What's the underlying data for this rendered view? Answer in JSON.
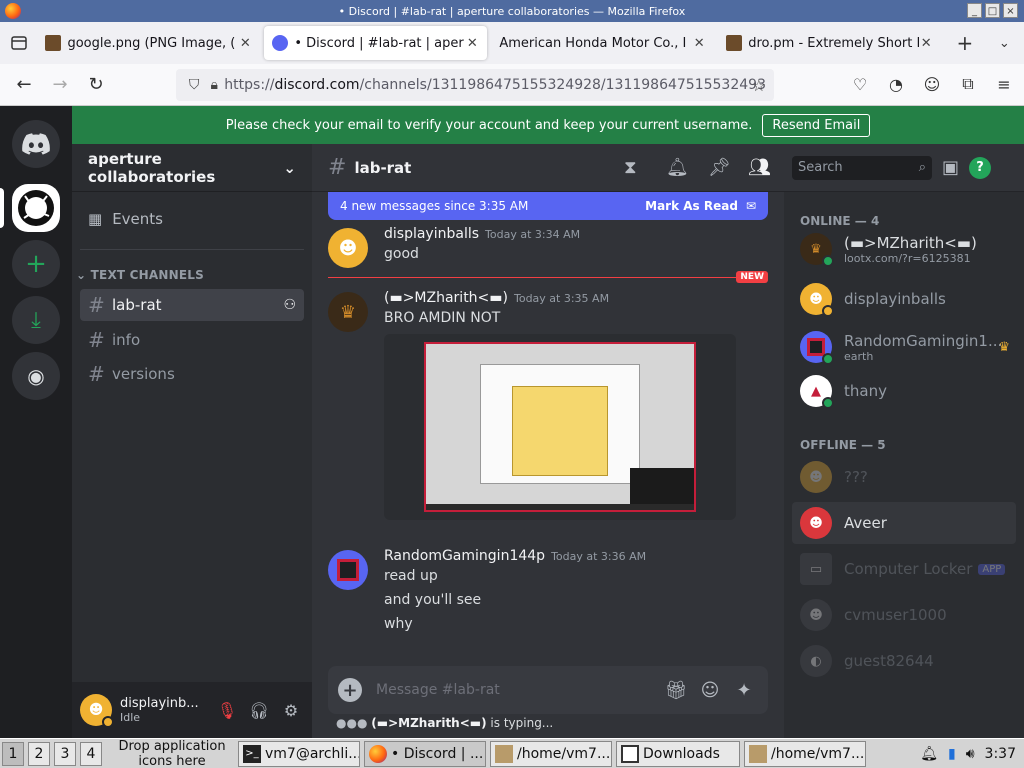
{
  "window": {
    "title": "• Discord | #lab-rat | aperture collaboratories — Mozilla Firefox",
    "controls": [
      "_",
      "□",
      "×"
    ]
  },
  "tabs": [
    {
      "title": "google.png (PNG Image, (",
      "active": false
    },
    {
      "title": "• Discord | #lab-rat | aper",
      "active": true
    },
    {
      "title": "American Honda Motor Co., I",
      "active": false
    },
    {
      "title": "dro.pm - Extremely Short I",
      "active": false
    }
  ],
  "nav": {
    "url_prefix": "https://",
    "url_host": "discord.com",
    "url_path": "/channels/1311986475155324928/131198647515532493"
  },
  "banner": {
    "text": "Please check your email to verify your account and keep your current username.",
    "button": "Resend Email"
  },
  "guild": {
    "name": "aperture collaboratories",
    "events": "Events",
    "category": "TEXT CHANNELS"
  },
  "channels": [
    {
      "name": "lab-rat",
      "selected": true
    },
    {
      "name": "info",
      "selected": false
    },
    {
      "name": "versions",
      "selected": false
    }
  ],
  "user": {
    "name": "displayinb...",
    "status": "Idle"
  },
  "chat": {
    "channel": "lab-rat",
    "new_banner": "4 new messages since 3:35 AM",
    "mark_read": "Mark As Read",
    "new_tag": "NEW",
    "messages": [
      {
        "author": "displayinballs",
        "time": "Today at 3:34 AM",
        "lines": [
          "good"
        ]
      },
      {
        "author": "(▬>MZharith<▬)",
        "time": "Today at 3:35 AM",
        "lines": [
          "BRO AMDIN NOT"
        ]
      },
      {
        "author": "RandomGamingin144p",
        "time": "Today at 3:36 AM",
        "lines": [
          "read up",
          "and you'll see",
          "why"
        ]
      }
    ],
    "composer_placeholder": "Message #lab-rat",
    "typing_user": "(▬>MZharith<▬)",
    "typing_suffix": " is typing..."
  },
  "search": {
    "placeholder": "Search"
  },
  "members": {
    "online_header": "ONLINE — 4",
    "offline_header": "OFFLINE — 5",
    "online": [
      {
        "name": "(▬>MZharith<▬)",
        "sub": "lootx.com/?r=6125381"
      },
      {
        "name": "displayinballs",
        "sub": ""
      },
      {
        "name": "RandomGamingin1...",
        "sub": "earth"
      },
      {
        "name": "thany",
        "sub": ""
      }
    ],
    "offline": [
      {
        "name": "???"
      },
      {
        "name": "Aveer"
      },
      {
        "name": "Computer Locker",
        "badge": "APP"
      },
      {
        "name": "cvmuser1000"
      },
      {
        "name": "guest82644"
      }
    ]
  },
  "taskbar": {
    "workspaces": [
      "1",
      "2",
      "3",
      "4"
    ],
    "drop_hint": "Drop application icons here",
    "tasks": [
      "vm7@archli...",
      "• Discord | ...",
      "/home/vm7...",
      "Downloads",
      "/home/vm7..."
    ],
    "clock": "3:37"
  },
  "colors": {
    "discord_blurple": "#5865f2",
    "banner_green": "#248046",
    "online_green": "#23a55a",
    "idle_yellow": "#f0b232",
    "new_red": "#f23f43"
  }
}
